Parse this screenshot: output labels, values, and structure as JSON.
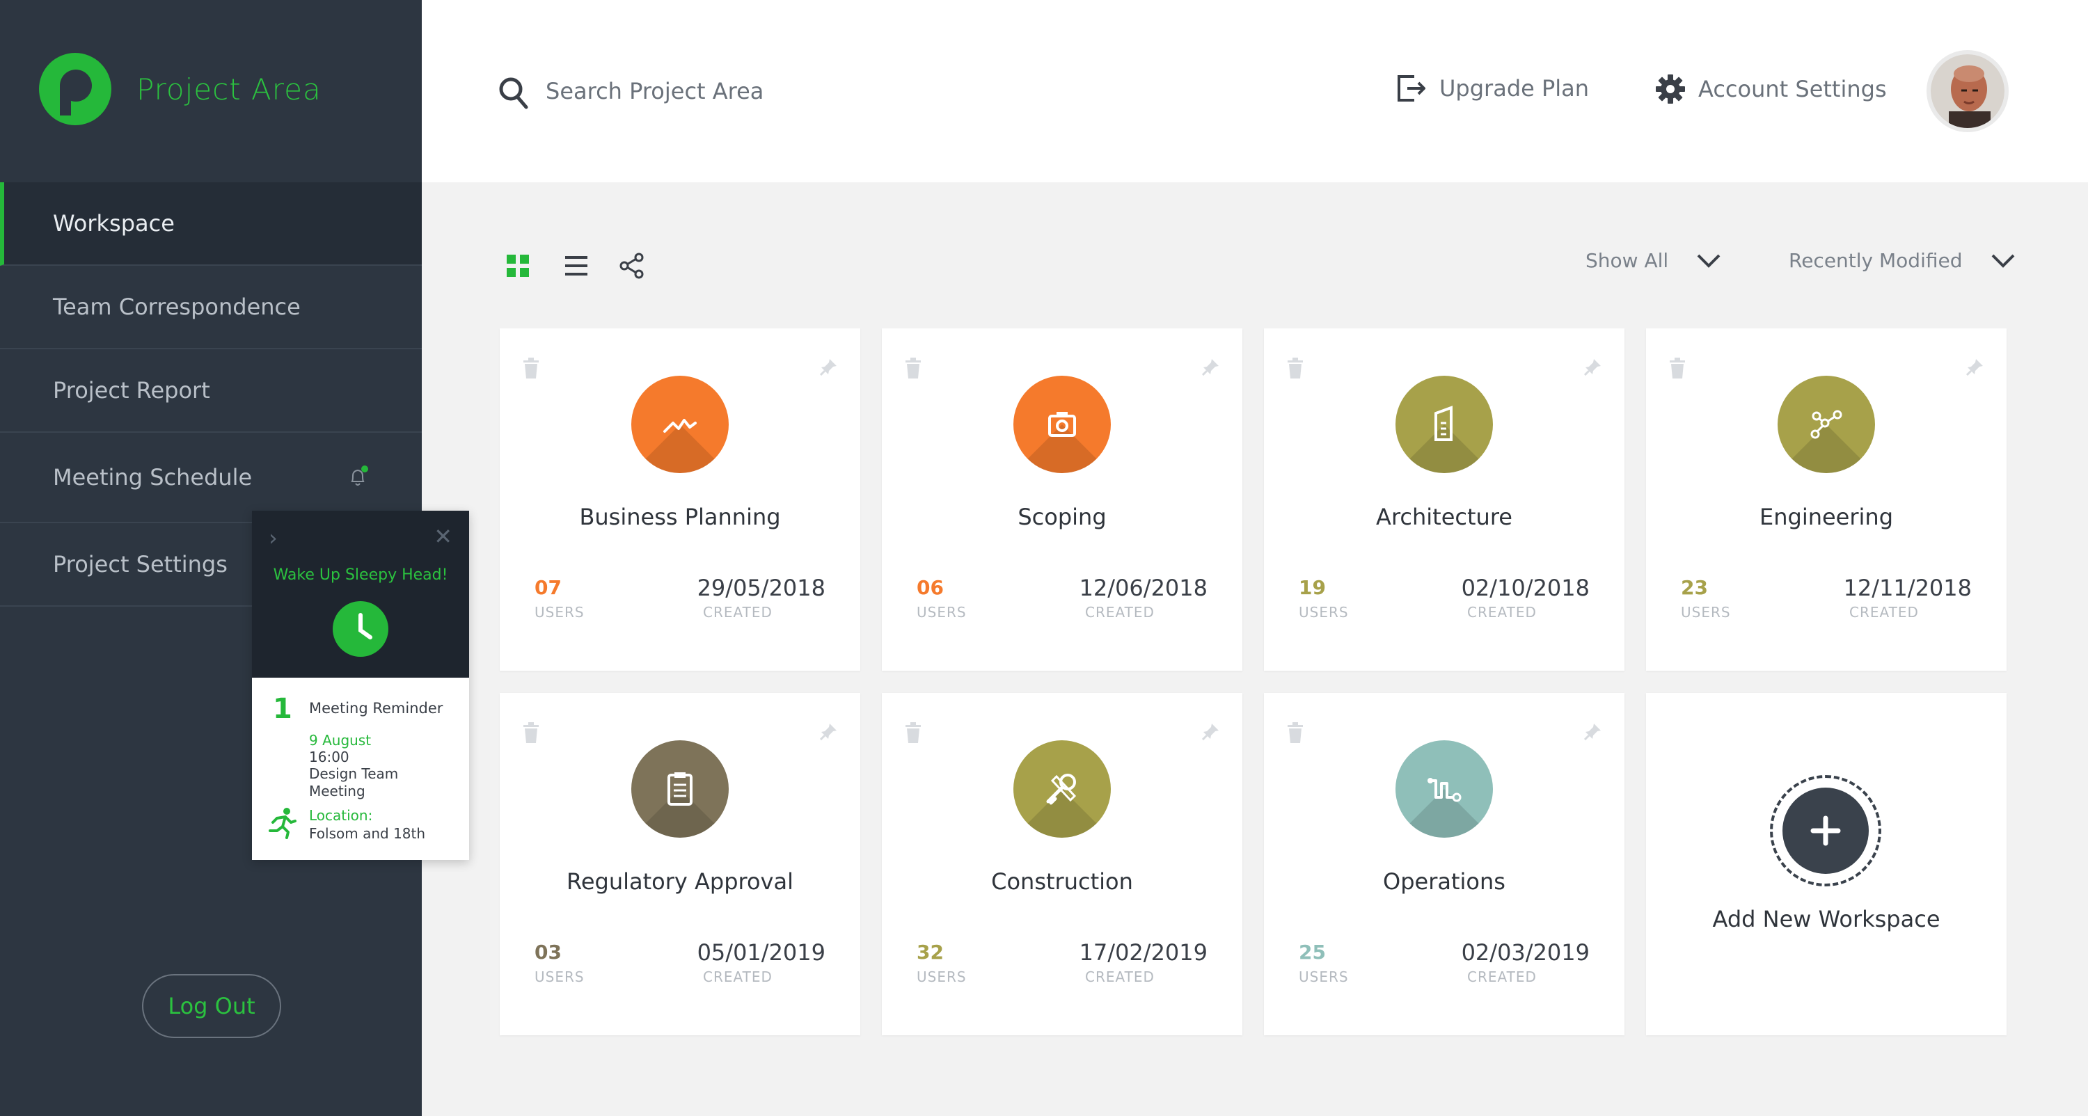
{
  "app": {
    "brand_name": "Project Area",
    "accent_color": "#25b83a"
  },
  "sidebar": {
    "items": [
      {
        "label": "Workspace",
        "active": true
      },
      {
        "label": "Team Correspondence",
        "active": false
      },
      {
        "label": "Project Report",
        "active": false
      },
      {
        "label": "Meeting Schedule",
        "active": false,
        "icon": "bell-icon"
      },
      {
        "label": "Project Settings",
        "active": false
      }
    ],
    "logout_label": "Log Out"
  },
  "notification": {
    "headline": "Wake Up Sleepy Head!",
    "count": "1",
    "title": "Meeting Reminder",
    "date": "9 August",
    "time": "16:00",
    "meeting": "Design Team Meeting",
    "location_label": "Location:",
    "location": "Folsom and 18th"
  },
  "header": {
    "search_placeholder": "Search Project Area",
    "upgrade_label": "Upgrade Plan",
    "account_label": "Account Settings"
  },
  "toolbar": {
    "filter_label": "Show All",
    "sort_label": "Recently Modified"
  },
  "cards": [
    {
      "title": "Business Planning",
      "users": "07",
      "date": "29/05/2018",
      "color": "#f57a2c",
      "icon": "activity-icon"
    },
    {
      "title": "Scoping",
      "users": "06",
      "date": "12/06/2018",
      "color": "#f57a2c",
      "icon": "scope-icon"
    },
    {
      "title": "Architecture",
      "users": "19",
      "date": "02/10/2018",
      "color": "#a7a14a",
      "icon": "building-icon"
    },
    {
      "title": "Engineering",
      "users": "23",
      "date": "12/11/2018",
      "color": "#a7a14a",
      "icon": "nodes-icon"
    },
    {
      "title": "Regulatory Approval",
      "users": "03",
      "date": "05/01/2019",
      "color": "#7e7359",
      "icon": "clipboard-icon"
    },
    {
      "title": "Construction",
      "users": "32",
      "date": "17/02/2019",
      "color": "#a7a14a",
      "icon": "tools-icon"
    },
    {
      "title": "Operations",
      "users": "25",
      "date": "02/03/2019",
      "color": "#8fbfb9",
      "icon": "flow-icon"
    }
  ],
  "card_labels": {
    "users": "USERS",
    "created": "CREATED"
  },
  "add_workspace_label": "Add New Workspace"
}
